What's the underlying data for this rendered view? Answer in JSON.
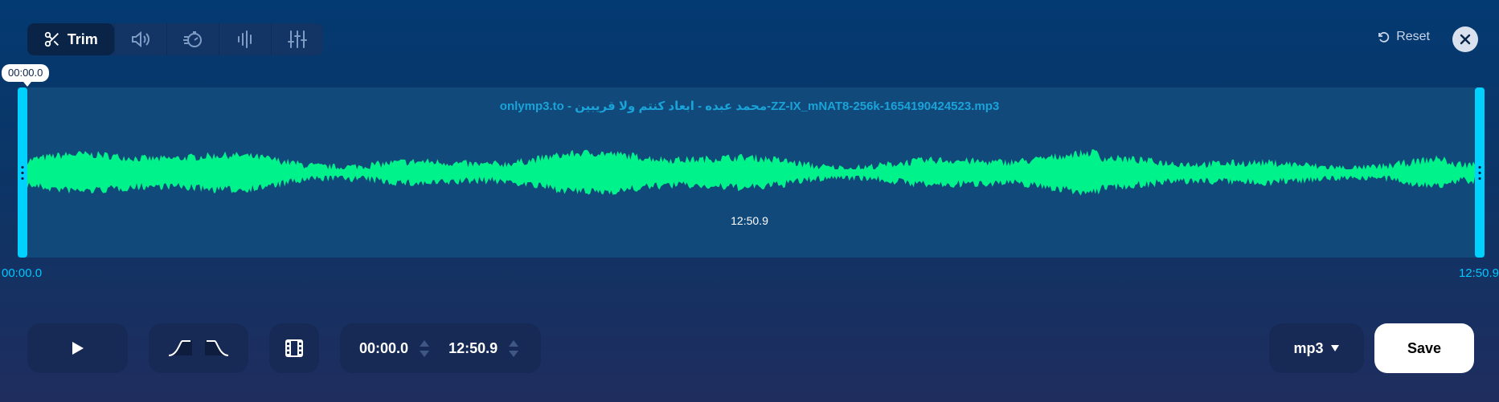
{
  "toolbar": {
    "active_tool_label": "Trim",
    "tools": [
      "volume-icon",
      "speed-icon",
      "pitch-icon",
      "equalizer-icon"
    ],
    "reset_label": "Reset"
  },
  "waveform": {
    "filename": "onlymp3.to - محمد عبده - ابعاد كنتم ولا قريبين-ZZ-IX_mNAT8-256k-1654190424523.mp3",
    "selection_duration": "12:50.9",
    "cursor_time": "00:00.0",
    "start_time": "00:00.0",
    "end_time": "12:50.9",
    "color": "#00f28a",
    "handle_color": "#00d1ff"
  },
  "controls": {
    "start_value": "00:00.0",
    "end_value": "12:50.9",
    "format": "mp3",
    "save_label": "Save"
  }
}
